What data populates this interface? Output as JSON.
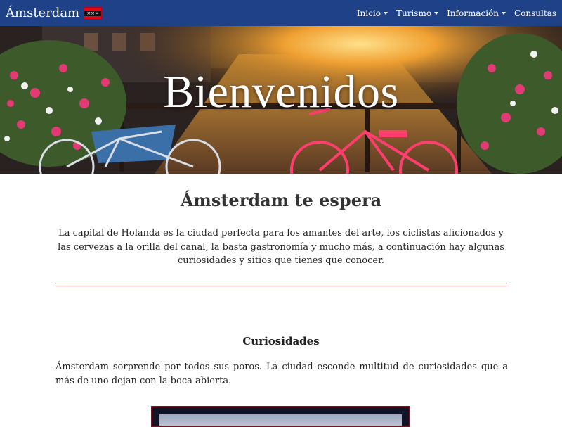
{
  "navbar": {
    "brand": "Ámsterdam",
    "flag_icon": "amsterdam-flag-icon",
    "flag_marks": "×××",
    "colors": {
      "background": "#1f4188",
      "text": "#ffffff"
    },
    "items": [
      {
        "label": "Inicio",
        "dropdown": true
      },
      {
        "label": "Turismo",
        "dropdown": true
      },
      {
        "label": "Información",
        "dropdown": true
      },
      {
        "label": "Consultas",
        "dropdown": false
      }
    ]
  },
  "hero": {
    "title": "Bienvenidos"
  },
  "intro": {
    "title": "Ámsterdam te espera",
    "text": "La capital de Holanda es la ciudad perfecta para los amantes del arte, los ciclistas aficionados y las cervezas a la orilla del canal, la basta gastronomía y mucho más, a continuación hay algunas curiosidades y sitios que tienes que conocer."
  },
  "curiosidades": {
    "title": "Curiosidades",
    "text": "Ámsterdam sorprende por todos sus poros. La ciudad esconde multitud de curiosidades que a más de uno dejan con la boca abierta."
  },
  "colors": {
    "divider": "#d46a6a",
    "frame_border": "#7a1020"
  }
}
